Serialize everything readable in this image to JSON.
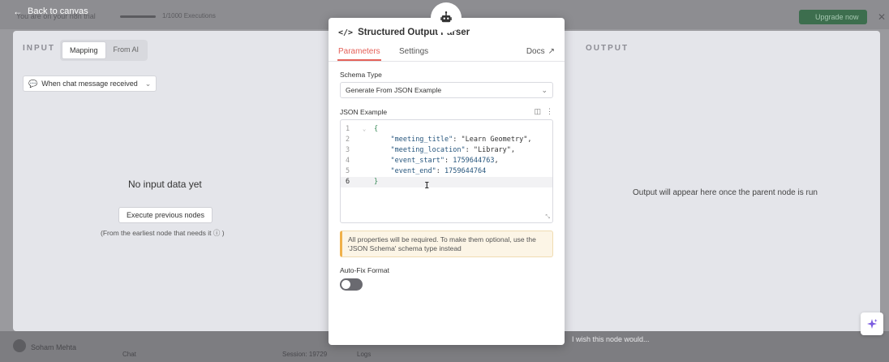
{
  "background": {
    "trial_text": "You are on your n8n trial",
    "executions": "1/1000 Executions",
    "upgrade_label": "Upgrade now",
    "user_name": "Soham Mehta",
    "chat_label": "Chat",
    "session_label": "Session: 19729",
    "logs_label": "Logs",
    "wish_text": "I wish this node would..."
  },
  "back_link": {
    "label": "Back to canvas"
  },
  "input_panel": {
    "title": "INPUT",
    "toggle": {
      "mapping": "Mapping",
      "from_ai": "From AI"
    },
    "trigger_select": "When chat message received",
    "empty_title": "No input data yet",
    "execute_button": "Execute previous nodes",
    "hint": "(From the earliest node that needs it ⓘ )"
  },
  "output_panel": {
    "title": "OUTPUT",
    "message": "Output will appear here once the parent node is run"
  },
  "modal": {
    "title": "Structured Output Parser",
    "tabs": {
      "parameters": "Parameters",
      "settings": "Settings",
      "docs": "Docs"
    },
    "schema_type_label": "Schema Type",
    "schema_type_value": "Generate From JSON Example",
    "json_example_label": "JSON Example",
    "json_lines": [
      {
        "n": "1",
        "brace": "{"
      },
      {
        "n": "2",
        "key": "\"meeting_title\"",
        "value": "\"Learn Geometry\""
      },
      {
        "n": "3",
        "key": "\"meeting_location\"",
        "value": "\"Library\""
      },
      {
        "n": "4",
        "key": "\"event_start\"",
        "value": "1759644763"
      },
      {
        "n": "5",
        "key": "\"event_end\"",
        "value": "1759644764"
      },
      {
        "n": "6",
        "brace": "}"
      }
    ],
    "notice": "All properties will be required. To make them optional, use the 'JSON Schema' schema type instead",
    "auto_fix_label": "Auto-Fix Format",
    "auto_fix_enabled": false
  },
  "colors": {
    "accent": "#e4625a",
    "notice_bg": "#fcf5e6",
    "switch_off": "#6a6a70"
  }
}
